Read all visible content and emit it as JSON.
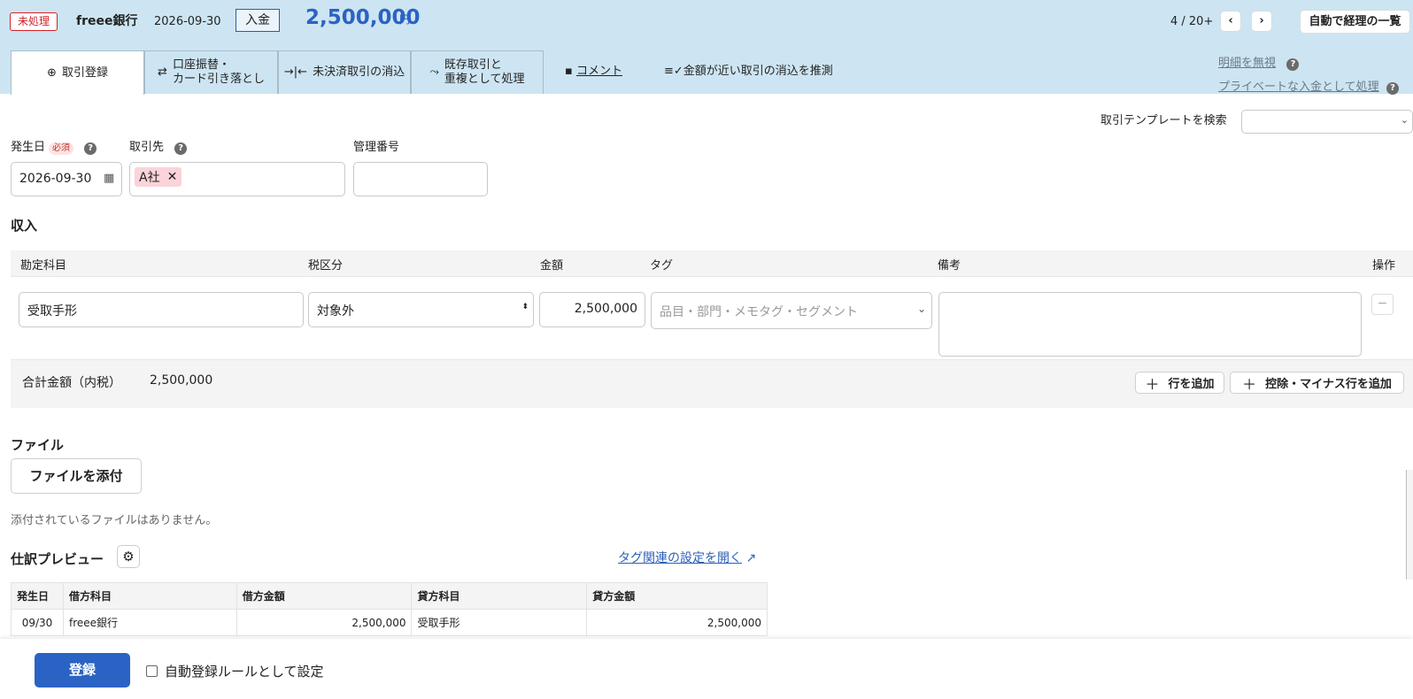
{
  "header": {
    "status": "未処理",
    "bank": "freee銀行",
    "date": "2026-09-30",
    "type": "入金",
    "amount": "2,500,000",
    "currency": "円",
    "pager": "4 / 20+",
    "list_button": "自動で経理の一覧"
  },
  "tabs": [
    {
      "label": "取引登録"
    },
    {
      "label_line1": "口座振替・",
      "label_line2": "カード引き落とし"
    },
    {
      "label": "未決済取引の消込"
    },
    {
      "label_line1": "既存取引と",
      "label_line2": "重複として処理"
    },
    {
      "label": "コメント"
    },
    {
      "label": "金額が近い取引の消込を推測"
    }
  ],
  "side_links": {
    "ignore": "明細を無視",
    "private": "プライベートな入金として処理"
  },
  "template_search": {
    "label": "取引テンプレートを検索"
  },
  "form": {
    "date_label": "発生日",
    "required": "必須",
    "date_value": "2026-09-30",
    "partner_label": "取引先",
    "partner_value": "A社",
    "mgmt_label": "管理番号",
    "mgmt_value": ""
  },
  "income": {
    "title": "収入",
    "columns": {
      "account": "勘定科目",
      "tax": "税区分",
      "amount": "金額",
      "tag": "タグ",
      "note": "備考",
      "ops": "操作"
    },
    "row": {
      "account": "受取手形",
      "tax": "対象外",
      "amount": "2,500,000",
      "tag_placeholder": "品目・部門・メモタグ・セグメント",
      "note": ""
    },
    "total_label": "合計金額（内税）",
    "total_value": "2,500,000",
    "add_row": "行を追加",
    "add_minus_row": "控除・マイナス行を追加"
  },
  "files": {
    "title": "ファイル",
    "attach_button": "ファイルを添付",
    "empty_text": "添付されているファイルはありません。"
  },
  "preview": {
    "title": "仕訳プレビュー",
    "tag_settings_link": "タグ関連の設定を開く",
    "columns": [
      "発生日",
      "借方科目",
      "借方金額",
      "貸方科目",
      "貸方金額"
    ],
    "rows": [
      [
        "09/30",
        "freee銀行",
        "2,500,000",
        "受取手形",
        "2,500,000"
      ]
    ]
  },
  "footer": {
    "submit": "登録",
    "auto_rule": "自動登録ルールとして設定"
  }
}
